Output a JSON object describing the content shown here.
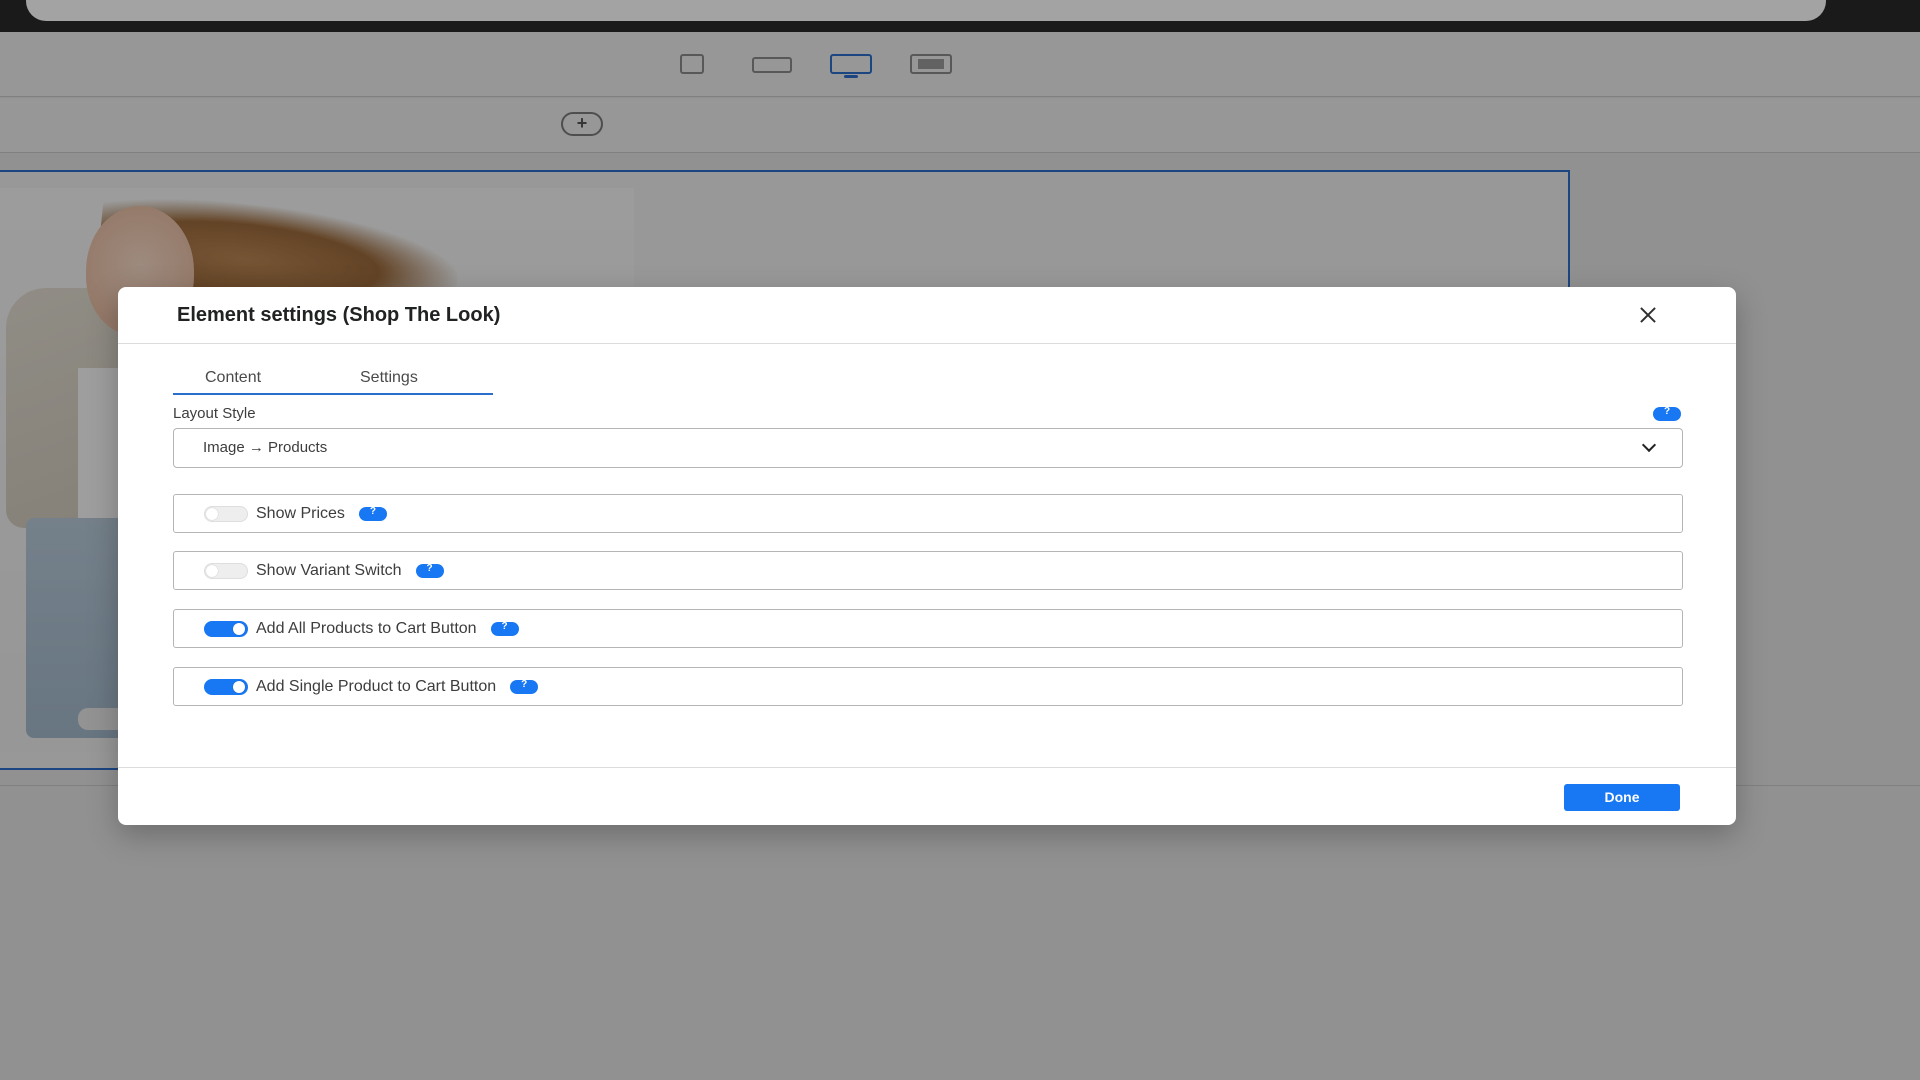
{
  "modal": {
    "title": "Element settings (Shop The Look)",
    "tabs": [
      {
        "label": "Content"
      },
      {
        "label": "Settings"
      }
    ],
    "active_tab": "Content",
    "layout_style": {
      "label": "Layout Style",
      "value": "Image → Products"
    },
    "toggles": [
      {
        "label": "Show Prices",
        "on": false
      },
      {
        "label": "Show Variant Switch",
        "on": false
      },
      {
        "label": "Add All Products to Cart Button",
        "on": true
      },
      {
        "label": "Add Single Product to Cart Button",
        "on": true
      }
    ],
    "done_label": "Done"
  },
  "editor": {
    "device_buttons": [
      "mobile-icon",
      "tablet-icon",
      "desktop-icon",
      "fullwidth-icon"
    ],
    "active_device": "desktop-icon",
    "add_section_icon": "plus-circle-icon"
  },
  "colors": {
    "accent": "#1877f2",
    "selection_outline": "#2c6ecb",
    "overlay": "rgba(0,0,0,0.36)"
  }
}
